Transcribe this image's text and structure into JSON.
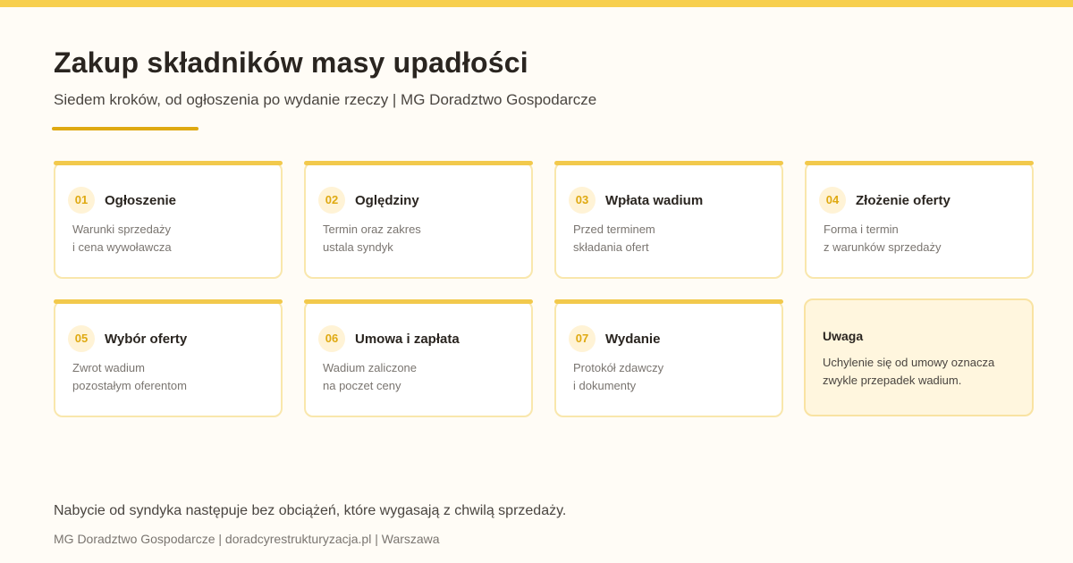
{
  "header": {
    "title": "Zakup składników masy upadłości",
    "subtitle": "Siedem kroków, od ogłoszenia po wydanie rzeczy | MG Doradztwo Gospodarcze"
  },
  "steps": [
    {
      "number": "01",
      "title": "Ogłoszenie",
      "desc": [
        "Warunki sprzedaży",
        "i cena wywoławcza"
      ]
    },
    {
      "number": "02",
      "title": "Oględziny",
      "desc": [
        "Termin oraz zakres",
        "ustala syndyk"
      ]
    },
    {
      "number": "03",
      "title": "Wpłata wadium",
      "desc": [
        "Przed terminem",
        "składania ofert"
      ]
    },
    {
      "number": "04",
      "title": "Złożenie oferty",
      "desc": [
        "Forma i termin",
        "z warunków sprzedaży"
      ]
    },
    {
      "number": "05",
      "title": "Wybór oferty",
      "desc": [
        "Zwrot wadium",
        "pozostałym oferentom"
      ]
    },
    {
      "number": "06",
      "title": "Umowa i zapłata",
      "desc": [
        "Wadium zaliczone",
        "na poczet ceny"
      ]
    },
    {
      "number": "07",
      "title": "Wydanie",
      "desc": [
        "Protokół zdawczy",
        "i dokumenty"
      ]
    }
  ],
  "note": {
    "title": "Uwaga",
    "text": "Uchylenie się od umowy oznacza zwykle przepadek wadium."
  },
  "footer": {
    "main": "Nabycie od syndyka następuje bez obciążeń, które wygasają z chwilą sprzedaży.",
    "meta": "MG Doradztwo Gospodarcze | doradcyrestrukturyzacja.pl | Warszawa"
  },
  "colors": {
    "accent": "#F2C94C",
    "accent_dark": "#DFA911",
    "background": "#FFFCF6",
    "note_background": "#FFF6DE"
  }
}
